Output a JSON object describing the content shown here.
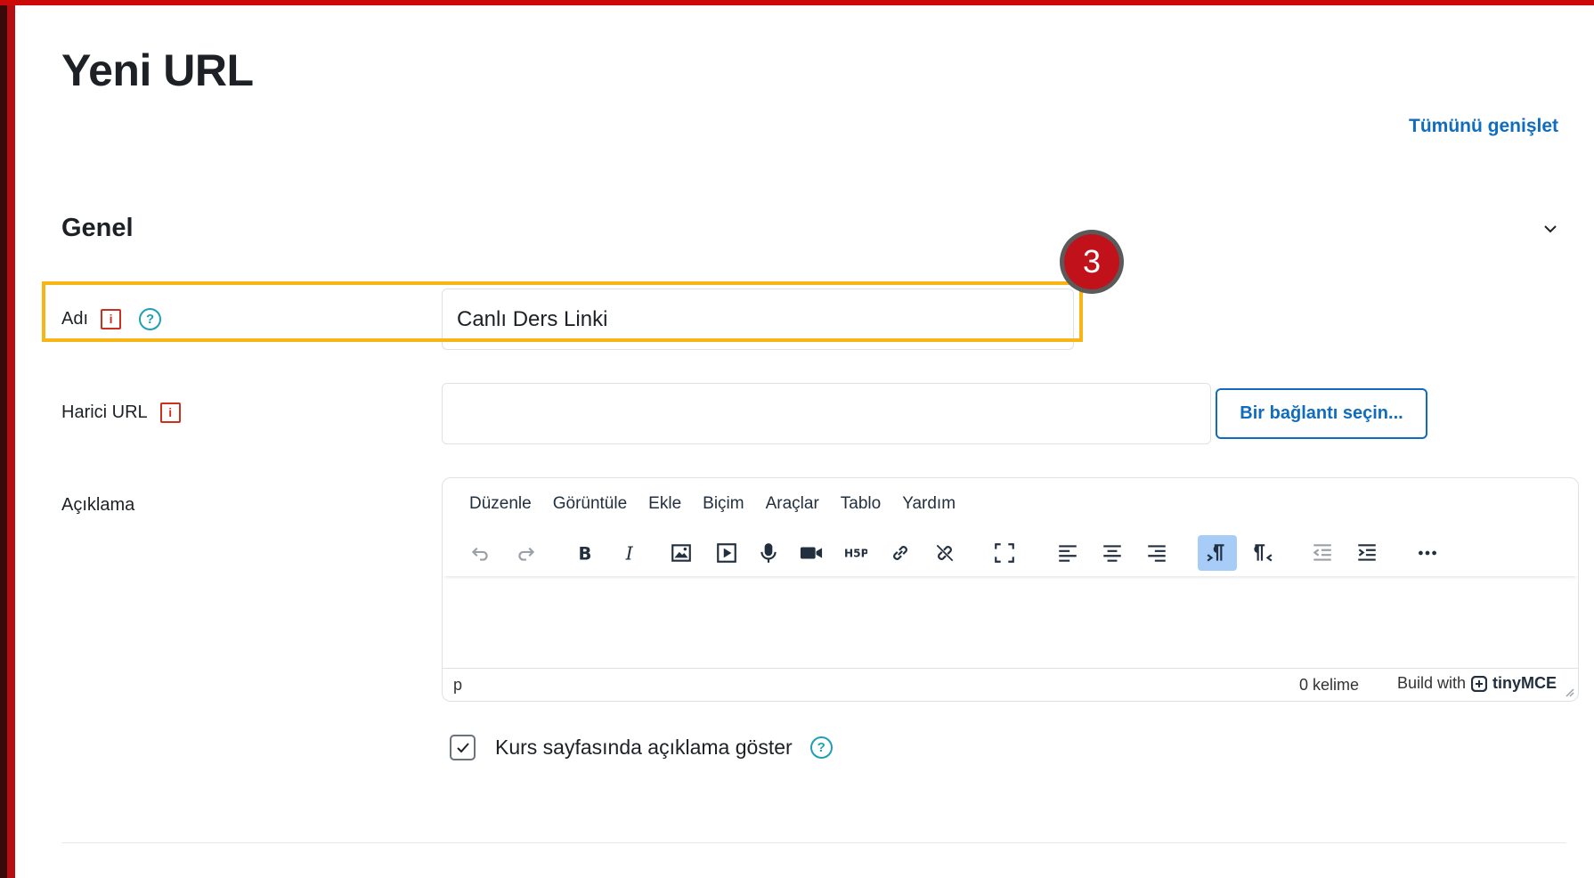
{
  "page": {
    "title": "Yeni URL",
    "expand_all": "Tümünü genişlet"
  },
  "section": {
    "title": "Genel"
  },
  "fields": {
    "name": {
      "label": "Adı",
      "value": "Canlı Ders Linki",
      "required_icon": "i",
      "help_icon": "?"
    },
    "external_url": {
      "label": "Harici URL",
      "value": "",
      "required_icon": "i",
      "choose_link_button": "Bir bağlantı seçin..."
    },
    "description": {
      "label": "Açıklama"
    }
  },
  "editor": {
    "menu": [
      "Düzenle",
      "Görüntüle",
      "Ekle",
      "Biçim",
      "Araçlar",
      "Tablo",
      "Yardım"
    ],
    "status_path": "p",
    "word_count": "0 kelime",
    "branding_prefix": "Build with",
    "branding_name": "tinyMCE"
  },
  "show_description": {
    "label": "Kurs sayfasında açıklama göster",
    "checked": true,
    "help_icon": "?"
  },
  "annotation": {
    "step": "3"
  },
  "colors": {
    "accent": "#0f6cbf",
    "required": "#ca3120",
    "help": "#1f9fb3",
    "highlight": "#f7b516",
    "badge": "#c1121c",
    "frame": "#b50f13"
  }
}
